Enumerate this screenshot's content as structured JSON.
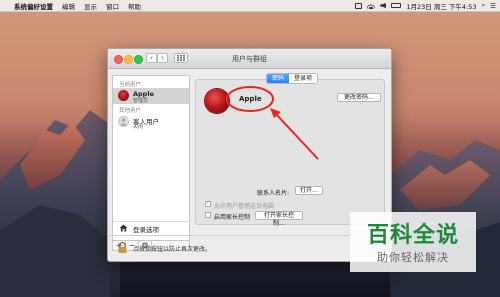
{
  "menubar": {
    "apple_icon": "apple-logo-icon",
    "app_name": "系统偏好设置",
    "menus": [
      "编辑",
      "显示",
      "窗口",
      "帮助"
    ],
    "clock": "1月23日 周三 下午4:53"
  },
  "window": {
    "title": "用户与群组",
    "back_label": "‹",
    "forward_label": "›"
  },
  "sidebar": {
    "current_users_header": "当前用户",
    "other_users_header": "其他用户",
    "current_user": {
      "name": "Apple",
      "role": "管理员"
    },
    "guest_user": {
      "name": "客人用户",
      "status": "关闭"
    },
    "login_options": "登录选项",
    "add_label": "+",
    "remove_label": "−",
    "gear_label": "⚙"
  },
  "main": {
    "tabs": [
      {
        "label": "密码",
        "active": true
      },
      {
        "label": "登录项",
        "active": false
      }
    ],
    "user_name": "Apple",
    "change_password_button": "更改密码…",
    "contact_card_label": "联系人名片:",
    "open_button": "打开…",
    "allow_admin_label": "允许用户管理这台电脑",
    "allow_admin_checked": true,
    "parental_controls_label": "启用家长控制",
    "parental_controls_checked": false,
    "open_parental_button": "打开家长控制…"
  },
  "lock": {
    "text": "点按锁按钮以防止再次更改。"
  },
  "watermark": {
    "line1": "百科全说",
    "line2": "助你轻松解决"
  },
  "colors": {
    "accent_tab": "#2d7ff1",
    "annotation_red": "#e8281f",
    "watermark_green": "#1c8a3c"
  }
}
